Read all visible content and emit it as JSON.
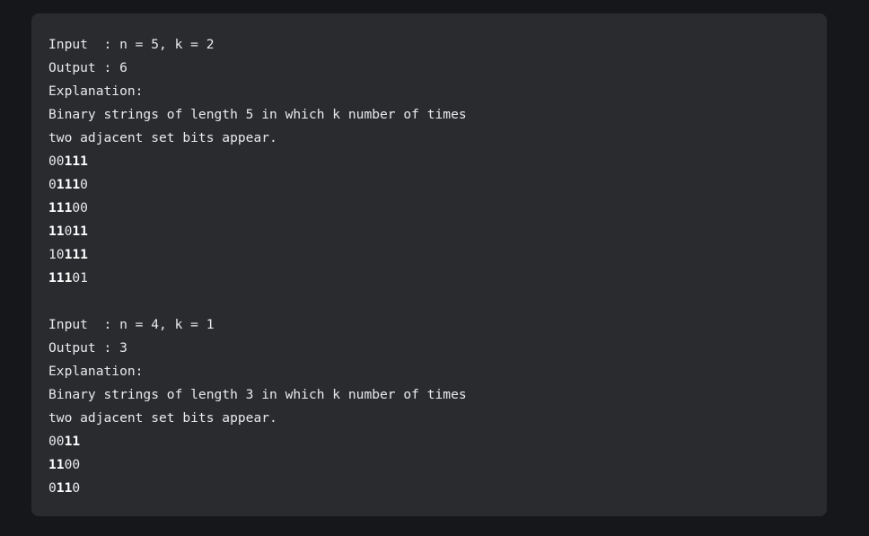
{
  "example1": {
    "input": "Input  : n = 5, k = 2",
    "output": "Output : 6",
    "explanation": "Explanation:",
    "desc1": "Binary strings of length 5 in which k number of times",
    "desc2": "two adjacent set bits appear.",
    "strings": [
      {
        "segments": [
          {
            "text": "00",
            "bold": false
          },
          {
            "text": "111",
            "bold": true
          }
        ]
      },
      {
        "segments": [
          {
            "text": "0",
            "bold": false
          },
          {
            "text": "111",
            "bold": true
          },
          {
            "text": "0",
            "bold": false
          }
        ]
      },
      {
        "segments": [
          {
            "text": "111",
            "bold": true
          },
          {
            "text": "00",
            "bold": false
          }
        ]
      },
      {
        "segments": [
          {
            "text": "11",
            "bold": true
          },
          {
            "text": "0",
            "bold": false
          },
          {
            "text": "11",
            "bold": true
          }
        ]
      },
      {
        "segments": [
          {
            "text": "10",
            "bold": false
          },
          {
            "text": "111",
            "bold": true
          }
        ]
      },
      {
        "segments": [
          {
            "text": "111",
            "bold": true
          },
          {
            "text": "01",
            "bold": false
          }
        ]
      }
    ]
  },
  "example2": {
    "input": "Input  : n = 4, k = 1",
    "output": "Output : 3",
    "explanation": "Explanation:",
    "desc1": "Binary strings of length 3 in which k number of times",
    "desc2": "two adjacent set bits appear.",
    "strings": [
      {
        "segments": [
          {
            "text": "00",
            "bold": false
          },
          {
            "text": "11",
            "bold": true
          }
        ]
      },
      {
        "segments": [
          {
            "text": "11",
            "bold": true
          },
          {
            "text": "00",
            "bold": false
          }
        ]
      },
      {
        "segments": [
          {
            "text": "0",
            "bold": false
          },
          {
            "text": "11",
            "bold": true
          },
          {
            "text": "0",
            "bold": false
          }
        ]
      }
    ]
  }
}
